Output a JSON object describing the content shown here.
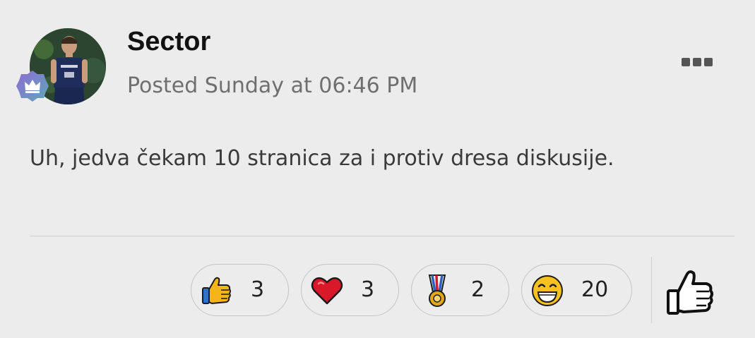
{
  "post": {
    "author": {
      "name": "Sector",
      "avatar_icon": "player-avatar",
      "rank_icon": "crown-badge-icon"
    },
    "meta": "Posted Sunday at 06:46 PM",
    "content": "Uh, jedva čekam 10 stranica za i protiv dresa diskusije.",
    "menu_icon": "more-options-icon"
  },
  "reactions": [
    {
      "icon": "thumbs-up-icon",
      "count": "3",
      "color": "#f5b417"
    },
    {
      "icon": "heart-icon",
      "count": "3",
      "color": "#d9182a"
    },
    {
      "icon": "medal-icon",
      "count": "2",
      "color": "#e3a81a"
    },
    {
      "icon": "grinning-face-icon",
      "count": "20",
      "color": "#f7c21f"
    }
  ],
  "like_button": {
    "icon": "thumbs-up-outline-icon"
  }
}
